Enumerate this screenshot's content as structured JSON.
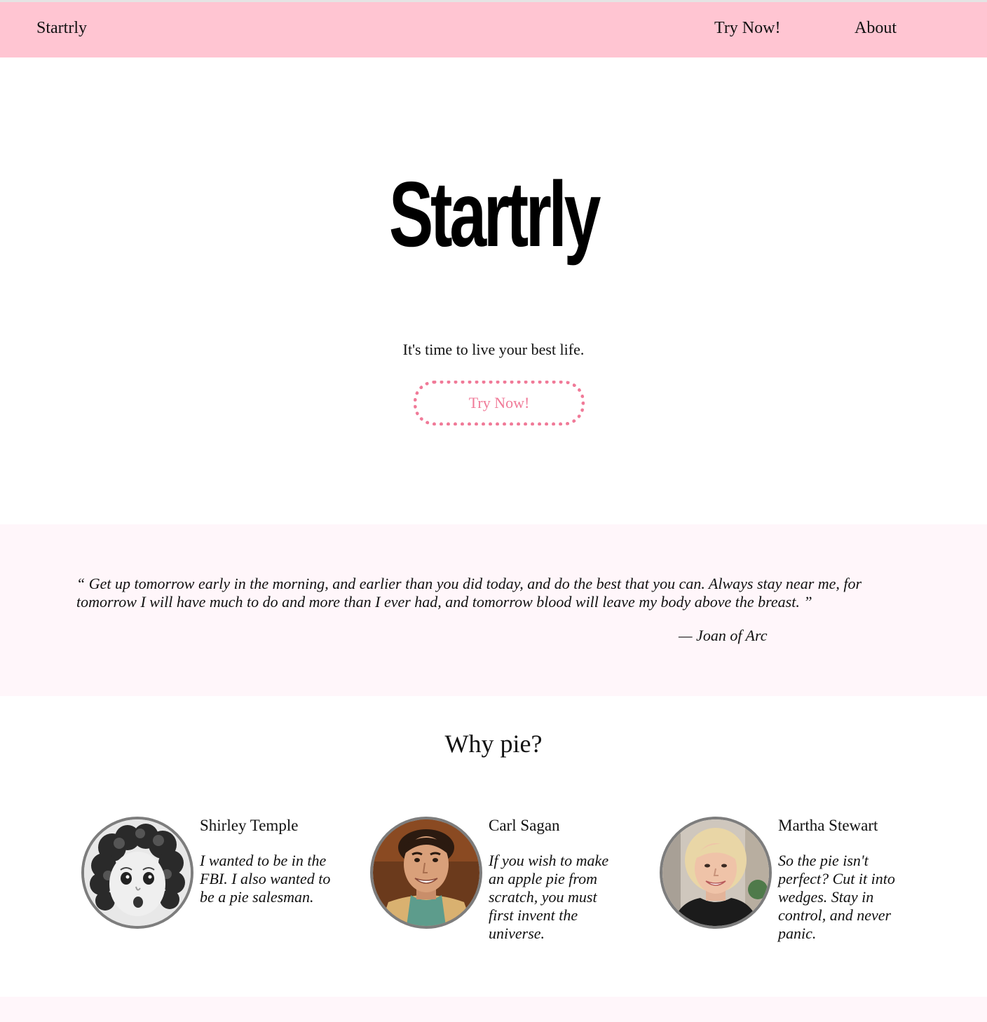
{
  "nav": {
    "brand": "Startrly",
    "links": [
      "Try Now!",
      "About"
    ]
  },
  "hero": {
    "title": "Startrly",
    "tagline": "It's time to live your best life.",
    "button_label": "Try Now!"
  },
  "quote": {
    "text": "“ Get up tomorrow early in the morning, and earlier than you did today, and do the best that you can. Always stay near me, for tomorrow I will have much to do and more than I ever had, and tomorrow blood will leave my body above the breast. ”",
    "author": "— Joan of Arc"
  },
  "why": {
    "title": "Why pie?",
    "cards": [
      {
        "name": "Shirley Temple",
        "quote": "I wanted to be in the FBI. I also wanted to be a pie salesman."
      },
      {
        "name": "Carl Sagan",
        "quote": "If you wish to make an apple pie from scratch, you must first invent the universe."
      },
      {
        "name": "Martha Stewart",
        "quote": "So the pie isn't perfect? Cut it into wedges. Stay in control, and never panic."
      }
    ]
  },
  "colors": {
    "navbar": "#ffc5d2",
    "accent": "#f07a98",
    "section_bg": "#fff6fa",
    "avatar_border": "#7d7d7d"
  }
}
